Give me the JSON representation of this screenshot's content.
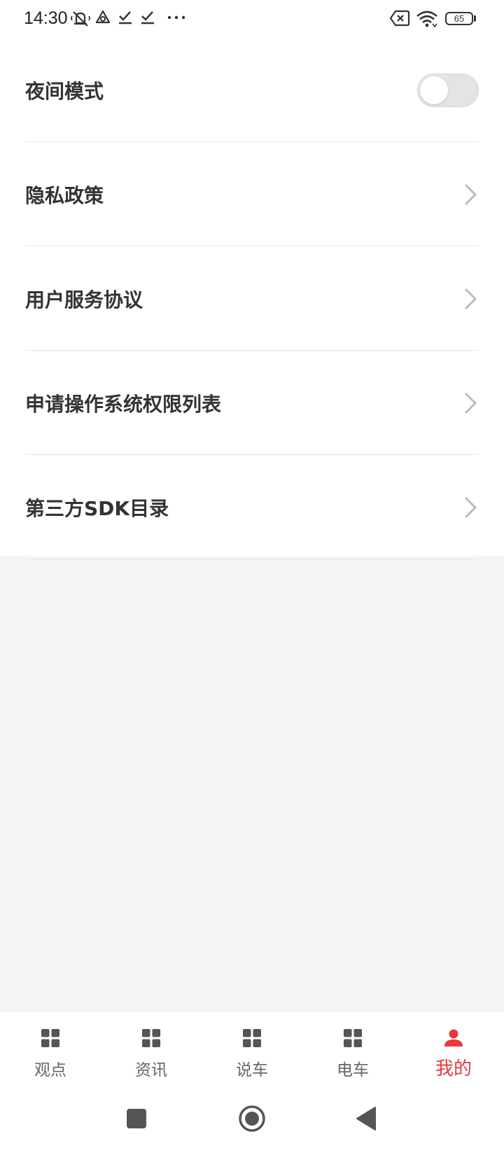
{
  "status_bar": {
    "time": "14:30",
    "icons": [
      "mute-icon",
      "sync-icon",
      "check-icon",
      "check-icon",
      "more-dots-icon",
      "sim-error-icon",
      "wifi-icon",
      "battery-icon"
    ],
    "battery_level": "65"
  },
  "settings": {
    "night_mode": {
      "label": "夜间模式",
      "enabled": false
    },
    "items": [
      {
        "label": "隐私政策"
      },
      {
        "label": "用户服务协议"
      },
      {
        "label": "申请操作系统权限列表"
      },
      {
        "label": "第三方SDK目录"
      }
    ]
  },
  "tab_bar": {
    "tabs": [
      {
        "label": "观点",
        "icon": "grid-icon",
        "active": false
      },
      {
        "label": "资讯",
        "icon": "grid-icon",
        "active": false
      },
      {
        "label": "说车",
        "icon": "grid-icon",
        "active": false
      },
      {
        "label": "电车",
        "icon": "grid-icon",
        "active": false
      },
      {
        "label": "我的",
        "icon": "person-icon",
        "active": true
      }
    ],
    "active_color": "#e8383d",
    "inactive_color": "#666666"
  },
  "system_nav": {
    "buttons": [
      "recent-apps-icon",
      "home-icon",
      "back-icon"
    ]
  }
}
